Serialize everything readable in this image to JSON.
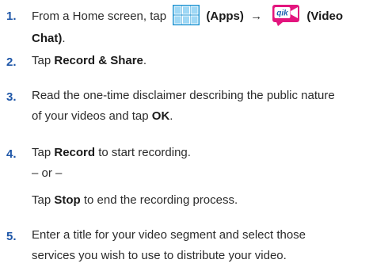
{
  "steps": [
    {
      "num": "1.",
      "text_start": "From a Home screen, tap",
      "apps_label": "(Apps)",
      "arrow": "→",
      "video_label_line1": "(Video",
      "video_label_line2": "Chat)",
      "period": "."
    },
    {
      "num": "2.",
      "text_start": "Tap",
      "bold": "Record & Share",
      "text_end": "."
    },
    {
      "num": "3.",
      "line1": "Read the one-time disclaimer describing the public nature",
      "line2_start": "of your videos and tap",
      "bold": "OK",
      "text_end": "."
    },
    {
      "num": "4.",
      "text_start": "Tap",
      "bold": "Record",
      "text_end": "to start recording.",
      "or_text": "– or –",
      "alt_start": "Tap",
      "alt_bold": "Stop",
      "alt_end": "to end the recording process."
    },
    {
      "num": "5.",
      "line1": "Enter a title for your video segment and select those",
      "line2": "services you wish to use to distribute your video."
    }
  ],
  "icons": {
    "apps": "apps-grid-icon",
    "video_chat": "qik-video-chat-icon",
    "video_chat_logo_text": "qik"
  },
  "colors": {
    "accent": "#1f57a8",
    "apps_icon": "#2196d3",
    "qik_pink": "#e3157e",
    "text": "#2b2b2b"
  }
}
